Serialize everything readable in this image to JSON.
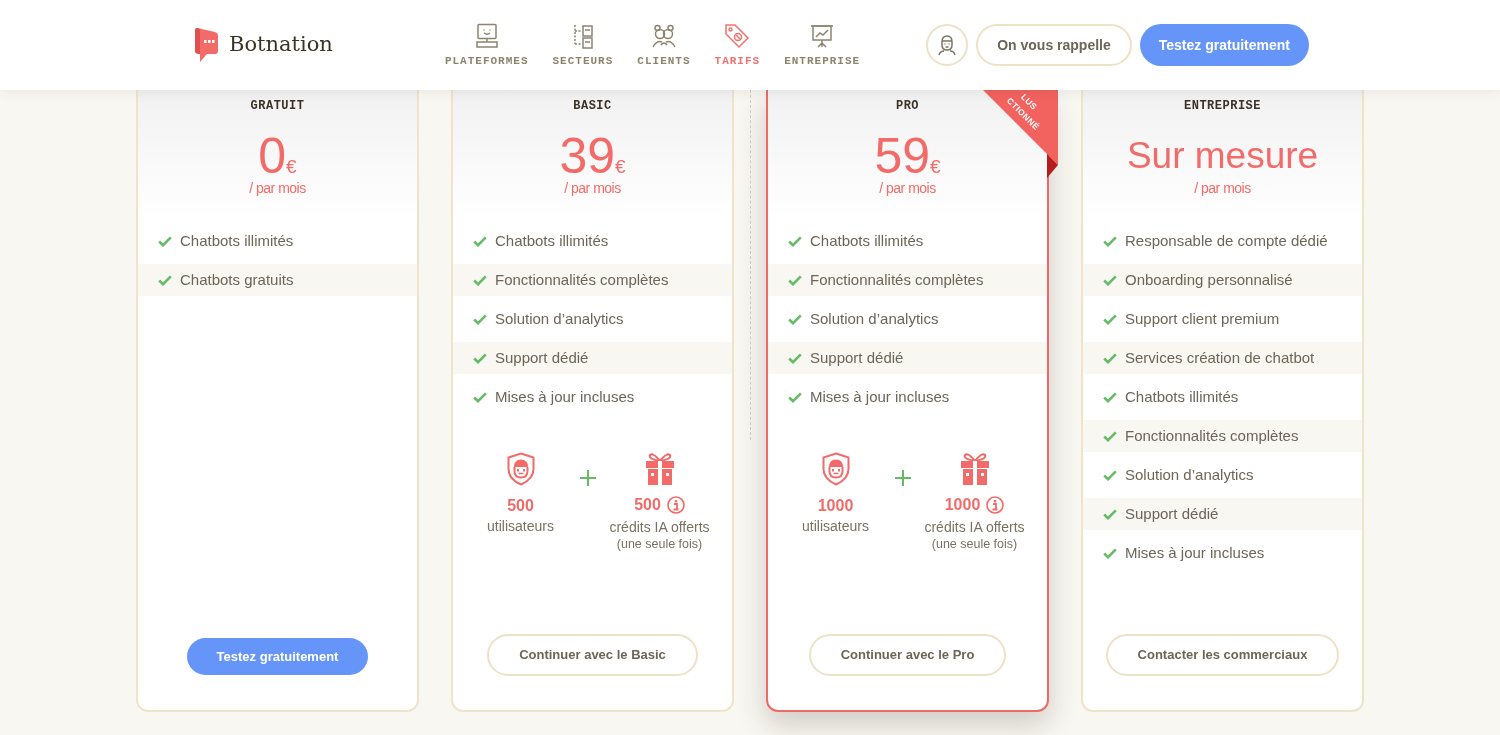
{
  "header": {
    "logo": "Botnation",
    "nav": [
      {
        "label": "PLATEFORMES",
        "selected": false
      },
      {
        "label": "SECTEURS",
        "selected": false
      },
      {
        "label": "CLIENTS",
        "selected": false
      },
      {
        "label": "TARIFS",
        "selected": true
      },
      {
        "label": "ENTREPRISE",
        "selected": false
      }
    ],
    "buttons": [
      {
        "label": "On vous rappelle",
        "kind": "outline"
      },
      {
        "label": "Testez gratuitement",
        "kind": "primary"
      }
    ]
  },
  "plans": [
    {
      "name": "GRATUIT",
      "price": "0",
      "currency": "€",
      "period": "/ par mois",
      "featured": false,
      "features": [
        "Chatbots illimités",
        "Chatbots gratuits"
      ],
      "button": {
        "label": "Testez gratuitement",
        "kind": "primary"
      }
    },
    {
      "name": "BASIC",
      "price": "39",
      "currency": "€",
      "period": "/ par mois",
      "featured": false,
      "features": [
        "Chatbots illimités",
        "Fonctionnalités complètes",
        "Solution d’analytics",
        "Support dédié",
        "Mises à jour incluses"
      ],
      "extras": {
        "users": {
          "count": "500",
          "label": "utilisateurs"
        },
        "credits": {
          "count": "500",
          "label": "crédits IA offerts",
          "note": "(une seule fois)"
        }
      },
      "button": {
        "label": "Continuer avec le Basic",
        "kind": "outline"
      }
    },
    {
      "name": "PRO",
      "price": "59",
      "currency": "€",
      "period": "/ par mois",
      "featured": true,
      "ribbon": [
        "LUS",
        "CTIONNÉ"
      ],
      "features": [
        "Chatbots illimités",
        "Fonctionnalités complètes",
        "Solution d’analytics",
        "Support dédié",
        "Mises à jour incluses"
      ],
      "extras": {
        "users": {
          "count": "1000",
          "label": "utilisateurs"
        },
        "credits": {
          "count": "1000",
          "label": "crédits IA offerts",
          "note": "(une seule fois)"
        }
      },
      "button": {
        "label": "Continuer avec le Pro",
        "kind": "outline"
      }
    },
    {
      "name": "ENTREPRISE",
      "price": "Sur mesure",
      "period": "/ par mois",
      "featured": false,
      "features": [
        "Responsable de compte dédié",
        "Onboarding personnalisé",
        "Support client premium",
        "Services création de chatbot",
        "Chatbots illimités",
        "Fonctionnalités complètes",
        "Solution d’analytics",
        "Support dédié",
        "Mises à jour incluses"
      ],
      "button": {
        "label": "Contacter les commerciaux",
        "kind": "outline"
      }
    }
  ]
}
